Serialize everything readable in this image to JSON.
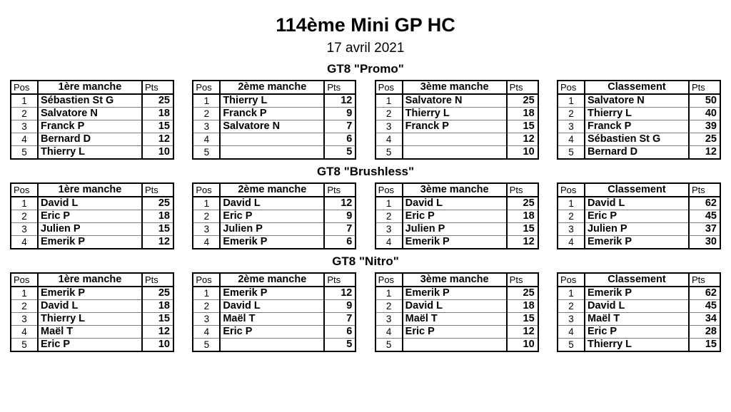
{
  "document": {
    "title": "114ème Mini GP HC",
    "date": "17 avril 2021"
  },
  "columns": {
    "pos": "Pos",
    "pts": "Pts"
  },
  "table_titles": {
    "manche1": "1ère manche",
    "manche2": "2ème manche",
    "manche3": "3ème manche",
    "classement": "Classement"
  },
  "sections": [
    {
      "title": "GT8 \"Promo\"",
      "tables": [
        {
          "header": "1ère manche",
          "rows": [
            {
              "pos": "1",
              "name": "Sébastien St G",
              "pts": "25"
            },
            {
              "pos": "2",
              "name": "Salvatore N",
              "pts": "18"
            },
            {
              "pos": "3",
              "name": "Franck P",
              "pts": "15"
            },
            {
              "pos": "4",
              "name": "Bernard D",
              "pts": "12"
            },
            {
              "pos": "5",
              "name": "Thierry L",
              "pts": "10"
            }
          ]
        },
        {
          "header": "2ème manche",
          "rows": [
            {
              "pos": "1",
              "name": "Thierry L",
              "pts": "12"
            },
            {
              "pos": "2",
              "name": "Franck P",
              "pts": "9"
            },
            {
              "pos": "3",
              "name": "Salvatore N",
              "pts": "7"
            },
            {
              "pos": "4",
              "name": "",
              "pts": "6"
            },
            {
              "pos": "5",
              "name": "",
              "pts": "5"
            }
          ]
        },
        {
          "header": "3ème manche",
          "rows": [
            {
              "pos": "1",
              "name": "Salvatore N",
              "pts": "25"
            },
            {
              "pos": "2",
              "name": "Thierry L",
              "pts": "18"
            },
            {
              "pos": "3",
              "name": "Franck P",
              "pts": "15"
            },
            {
              "pos": "4",
              "name": "",
              "pts": "12"
            },
            {
              "pos": "5",
              "name": "",
              "pts": "10"
            }
          ]
        },
        {
          "header": "Classement",
          "rows": [
            {
              "pos": "1",
              "name": "Salvatore N",
              "pts": "50"
            },
            {
              "pos": "2",
              "name": "Thierry L",
              "pts": "40"
            },
            {
              "pos": "3",
              "name": "Franck P",
              "pts": "39"
            },
            {
              "pos": "4",
              "name": "Sébastien St G",
              "pts": "25"
            },
            {
              "pos": "5",
              "name": "Bernard D",
              "pts": "12"
            }
          ]
        }
      ]
    },
    {
      "title": "GT8 \"Brushless\"",
      "tables": [
        {
          "header": "1ère manche",
          "rows": [
            {
              "pos": "1",
              "name": "David L",
              "pts": "25"
            },
            {
              "pos": "2",
              "name": "Eric P",
              "pts": "18"
            },
            {
              "pos": "3",
              "name": "Julien P",
              "pts": "15"
            },
            {
              "pos": "4",
              "name": "Emerik P",
              "pts": "12"
            }
          ]
        },
        {
          "header": "2ème manche",
          "rows": [
            {
              "pos": "1",
              "name": "David L",
              "pts": "12"
            },
            {
              "pos": "2",
              "name": "Eric P",
              "pts": "9"
            },
            {
              "pos": "3",
              "name": "Julien P",
              "pts": "7"
            },
            {
              "pos": "4",
              "name": "Emerik P",
              "pts": "6"
            }
          ]
        },
        {
          "header": "3ème manche",
          "rows": [
            {
              "pos": "1",
              "name": "David L",
              "pts": "25"
            },
            {
              "pos": "2",
              "name": "Eric P",
              "pts": "18"
            },
            {
              "pos": "3",
              "name": "Julien P",
              "pts": "15"
            },
            {
              "pos": "4",
              "name": "Emerik P",
              "pts": "12"
            }
          ]
        },
        {
          "header": "Classement",
          "rows": [
            {
              "pos": "1",
              "name": "David L",
              "pts": "62"
            },
            {
              "pos": "2",
              "name": "Eric P",
              "pts": "45"
            },
            {
              "pos": "3",
              "name": "Julien P",
              "pts": "37"
            },
            {
              "pos": "4",
              "name": "Emerik P",
              "pts": "30"
            }
          ]
        }
      ]
    },
    {
      "title": "GT8 \"Nitro\"",
      "tables": [
        {
          "header": "1ère manche",
          "rows": [
            {
              "pos": "1",
              "name": "Emerik P",
              "pts": "25"
            },
            {
              "pos": "2",
              "name": "David L",
              "pts": "18"
            },
            {
              "pos": "3",
              "name": "Thierry L",
              "pts": "15"
            },
            {
              "pos": "4",
              "name": "Maël T",
              "pts": "12"
            },
            {
              "pos": "5",
              "name": "Eric P",
              "pts": "10"
            }
          ]
        },
        {
          "header": "2ème manche",
          "rows": [
            {
              "pos": "1",
              "name": "Emerik P",
              "pts": "12"
            },
            {
              "pos": "2",
              "name": "David L",
              "pts": "9"
            },
            {
              "pos": "3",
              "name": "Maël T",
              "pts": "7"
            },
            {
              "pos": "4",
              "name": "Eric P",
              "pts": "6"
            },
            {
              "pos": "5",
              "name": "",
              "pts": "5"
            }
          ]
        },
        {
          "header": "3ème manche",
          "rows": [
            {
              "pos": "1",
              "name": "Emerik P",
              "pts": "25"
            },
            {
              "pos": "2",
              "name": "David L",
              "pts": "18"
            },
            {
              "pos": "3",
              "name": "Maël T",
              "pts": "15"
            },
            {
              "pos": "4",
              "name": "Eric P",
              "pts": "12"
            },
            {
              "pos": "5",
              "name": "",
              "pts": "10"
            }
          ]
        },
        {
          "header": "Classement",
          "rows": [
            {
              "pos": "1",
              "name": "Emerik P",
              "pts": "62"
            },
            {
              "pos": "2",
              "name": "David L",
              "pts": "45"
            },
            {
              "pos": "3",
              "name": "Maël T",
              "pts": "34"
            },
            {
              "pos": "4",
              "name": "Eric P",
              "pts": "28"
            },
            {
              "pos": "5",
              "name": "Thierry L",
              "pts": "15"
            }
          ]
        }
      ]
    }
  ]
}
